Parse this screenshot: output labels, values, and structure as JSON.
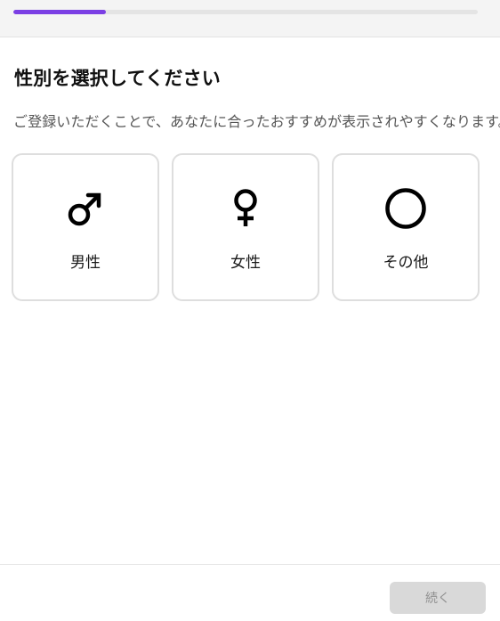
{
  "progress": {
    "fraction": 0.2,
    "accent": "#7b3fe4"
  },
  "title": "性別を選択してください",
  "subtitle": "ご登録いただくことで、あなたに合ったおすすめが表示されやすくなります。",
  "options": [
    {
      "label": "男性",
      "icon": "male-symbol-icon"
    },
    {
      "label": "女性",
      "icon": "female-symbol-icon"
    },
    {
      "label": "その他",
      "icon": "circle-icon"
    }
  ],
  "footer": {
    "continue_label": "続く",
    "continue_enabled": false
  }
}
